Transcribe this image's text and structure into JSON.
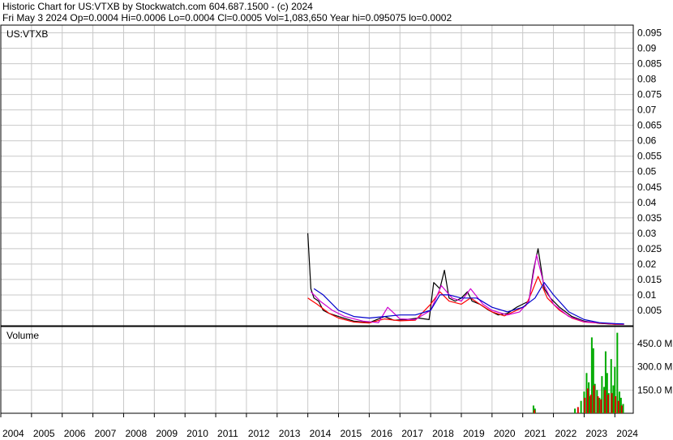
{
  "header": {
    "line1": "Historic Chart for US:VTXB by Stockwatch.com 604.687.1500 - (c) 2024",
    "line2": "Fri May  3 2024  Op=0.0004  Hi=0.0006  Lo=0.0004  Cl=0.0005  Vol=1,083,650  Year hi=0.095075  lo=0.0002"
  },
  "chart_data": [
    {
      "type": "line",
      "symbol_label": "US:VTXB",
      "ylim": [
        0,
        0.0975
      ],
      "yticks": [
        0.005,
        0.01,
        0.015,
        0.02,
        0.025,
        0.03,
        0.035,
        0.04,
        0.045,
        0.05,
        0.055,
        0.06,
        0.065,
        0.07,
        0.075,
        0.08,
        0.085,
        0.09,
        0.095
      ],
      "ytick_labels": [
        "0.005",
        "0.01",
        "0.015",
        "0.02",
        "0.025",
        "0.03",
        "0.035",
        "0.04",
        "0.045",
        "0.05",
        "0.055",
        "0.06",
        "0.065",
        "0.07",
        "0.075",
        "0.08",
        "0.085",
        "0.09",
        "0.095"
      ],
      "grid": true,
      "series": [
        {
          "color": "#000000",
          "x": [
            2014.0,
            2014.1,
            2014.2,
            2014.35,
            2014.5,
            2014.7,
            2015.0,
            2015.5,
            2016.0,
            2016.5,
            2016.8,
            2017.2,
            2017.6,
            2017.95,
            2018.1,
            2018.3,
            2018.45,
            2018.6,
            2018.8,
            2019.0,
            2019.2,
            2019.35,
            2019.6,
            2019.9,
            2020.2,
            2020.5,
            2020.8,
            2021.0,
            2021.2,
            2021.35,
            2021.5,
            2021.7,
            2021.9,
            2022.2,
            2022.6,
            2023.0,
            2023.5,
            2024.0,
            2024.3
          ],
          "y": [
            0.03,
            0.012,
            0.009,
            0.008,
            0.005,
            0.004,
            0.003,
            0.0015,
            0.001,
            0.003,
            0.0018,
            0.002,
            0.0025,
            0.002,
            0.014,
            0.012,
            0.018,
            0.009,
            0.008,
            0.009,
            0.011,
            0.008,
            0.007,
            0.005,
            0.0035,
            0.004,
            0.006,
            0.007,
            0.008,
            0.018,
            0.025,
            0.012,
            0.009,
            0.006,
            0.003,
            0.0015,
            0.0008,
            0.0005,
            0.0005
          ]
        },
        {
          "color": "#ff0000",
          "x": [
            2014.0,
            2014.3,
            2014.7,
            2015.0,
            2015.5,
            2016.0,
            2016.5,
            2017.0,
            2017.5,
            2018.0,
            2018.3,
            2018.6,
            2019.0,
            2019.3,
            2019.6,
            2020.0,
            2020.4,
            2020.8,
            2021.1,
            2021.3,
            2021.5,
            2021.8,
            2022.2,
            2022.6,
            2023.0,
            2024.0,
            2024.3
          ],
          "y": [
            0.009,
            0.007,
            0.004,
            0.0025,
            0.0012,
            0.0009,
            0.0022,
            0.0016,
            0.0018,
            0.007,
            0.011,
            0.008,
            0.007,
            0.009,
            0.007,
            0.0045,
            0.0032,
            0.005,
            0.0065,
            0.011,
            0.016,
            0.009,
            0.005,
            0.0025,
            0.0012,
            0.0005,
            0.0005
          ]
        },
        {
          "color": "#d000d0",
          "x": [
            2014.1,
            2014.4,
            2014.8,
            2015.2,
            2015.8,
            2016.3,
            2016.6,
            2017.0,
            2017.5,
            2018.0,
            2018.35,
            2018.7,
            2019.0,
            2019.3,
            2019.7,
            2020.0,
            2020.5,
            2020.9,
            2021.2,
            2021.45,
            2021.7,
            2022.0,
            2022.5,
            2023.0,
            2024.0,
            2024.3
          ],
          "y": [
            0.011,
            0.008,
            0.005,
            0.003,
            0.0015,
            0.001,
            0.006,
            0.0022,
            0.002,
            0.005,
            0.013,
            0.009,
            0.008,
            0.012,
            0.007,
            0.005,
            0.0035,
            0.0045,
            0.008,
            0.023,
            0.013,
            0.007,
            0.003,
            0.0013,
            0.0006,
            0.0005
          ]
        },
        {
          "color": "#0000cc",
          "x": [
            2014.2,
            2014.5,
            2015.0,
            2015.5,
            2016.0,
            2016.5,
            2017.0,
            2017.5,
            2018.0,
            2018.3,
            2018.6,
            2019.0,
            2019.5,
            2020.0,
            2020.5,
            2021.0,
            2021.4,
            2021.7,
            2022.0,
            2022.5,
            2023.0,
            2023.5,
            2024.0,
            2024.3
          ],
          "y": [
            0.012,
            0.01,
            0.005,
            0.003,
            0.0025,
            0.003,
            0.0035,
            0.0035,
            0.005,
            0.01,
            0.01,
            0.009,
            0.009,
            0.006,
            0.0045,
            0.006,
            0.009,
            0.014,
            0.01,
            0.0045,
            0.002,
            0.001,
            0.0007,
            0.0006
          ]
        }
      ]
    },
    {
      "type": "bar",
      "title": "Volume",
      "ylim": [
        0,
        560
      ],
      "yticks": [
        150,
        300,
        450
      ],
      "ytick_labels": [
        "150.0 M",
        "300.0 M",
        "450.0 M"
      ],
      "grid": true,
      "series": [
        {
          "color": "#00aa00",
          "x": [
            2021.35,
            2021.4,
            2022.7,
            2022.9,
            2023.0,
            2023.08,
            2023.15,
            2023.2,
            2023.25,
            2023.3,
            2023.35,
            2023.42,
            2023.5,
            2023.58,
            2023.65,
            2023.7,
            2023.75,
            2023.8,
            2023.88,
            2023.95,
            2024.0,
            2024.08,
            2024.15,
            2024.2,
            2024.27
          ],
          "y": [
            50,
            30,
            30,
            80,
            140,
            260,
            200,
            110,
            490,
            420,
            190,
            150,
            100,
            240,
            170,
            400,
            260,
            130,
            350,
            180,
            300,
            520,
            140,
            100,
            60
          ]
        },
        {
          "color": "#dd0000",
          "x": [
            2021.38,
            2022.8,
            2023.02,
            2023.12,
            2023.22,
            2023.32,
            2023.45,
            2023.55,
            2023.68,
            2023.78,
            2023.9,
            2024.02,
            2024.12,
            2024.22
          ],
          "y": [
            20,
            40,
            100,
            160,
            120,
            180,
            110,
            90,
            150,
            120,
            130,
            110,
            80,
            50
          ]
        }
      ]
    },
    {
      "type": "axis",
      "x_labels": [
        "2004",
        "2005",
        "2006",
        "2007",
        "2008",
        "2009",
        "2010",
        "2011",
        "2012",
        "2013",
        "2014",
        "2015",
        "2016",
        "2017",
        "2018",
        "2019",
        "2020",
        "2021",
        "2022",
        "2023",
        "2024"
      ]
    }
  ]
}
